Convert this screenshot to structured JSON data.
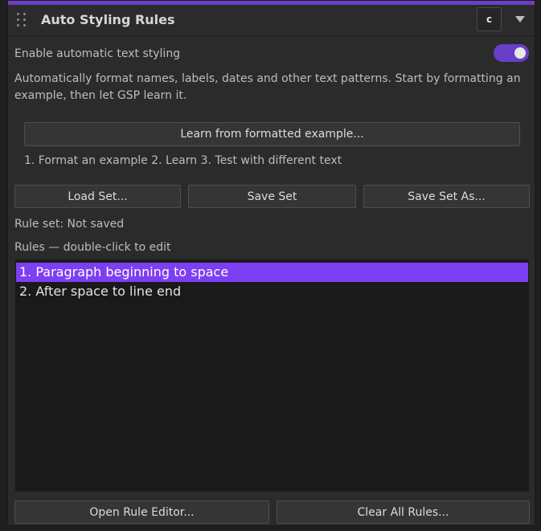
{
  "header": {
    "title": "Auto Styling Rules",
    "reset_label": "c"
  },
  "enable": {
    "label": "Enable automatic text styling",
    "on": true
  },
  "description": "Automatically format names, labels, dates and other text patterns. Start by formatting an example, then let GSP learn it.",
  "learn": {
    "button_label": "Learn from formatted example...",
    "steps": "1. Format an example  2. Learn  3. Test with different text"
  },
  "set_buttons": {
    "load": "Load Set...",
    "save": "Save Set",
    "save_as": "Save Set As..."
  },
  "rule_set_status": "Rule set: Not saved",
  "rules_label": "Rules — double-click to edit",
  "rules": [
    {
      "label": "1. Paragraph beginning to space",
      "selected": true
    },
    {
      "label": "2. After space to line end",
      "selected": false
    }
  ],
  "footer": {
    "open_editor": "Open Rule Editor...",
    "clear_all": "Clear All Rules..."
  },
  "colors": {
    "accent": "#6a3fc8",
    "selection": "#7d3ff2"
  }
}
